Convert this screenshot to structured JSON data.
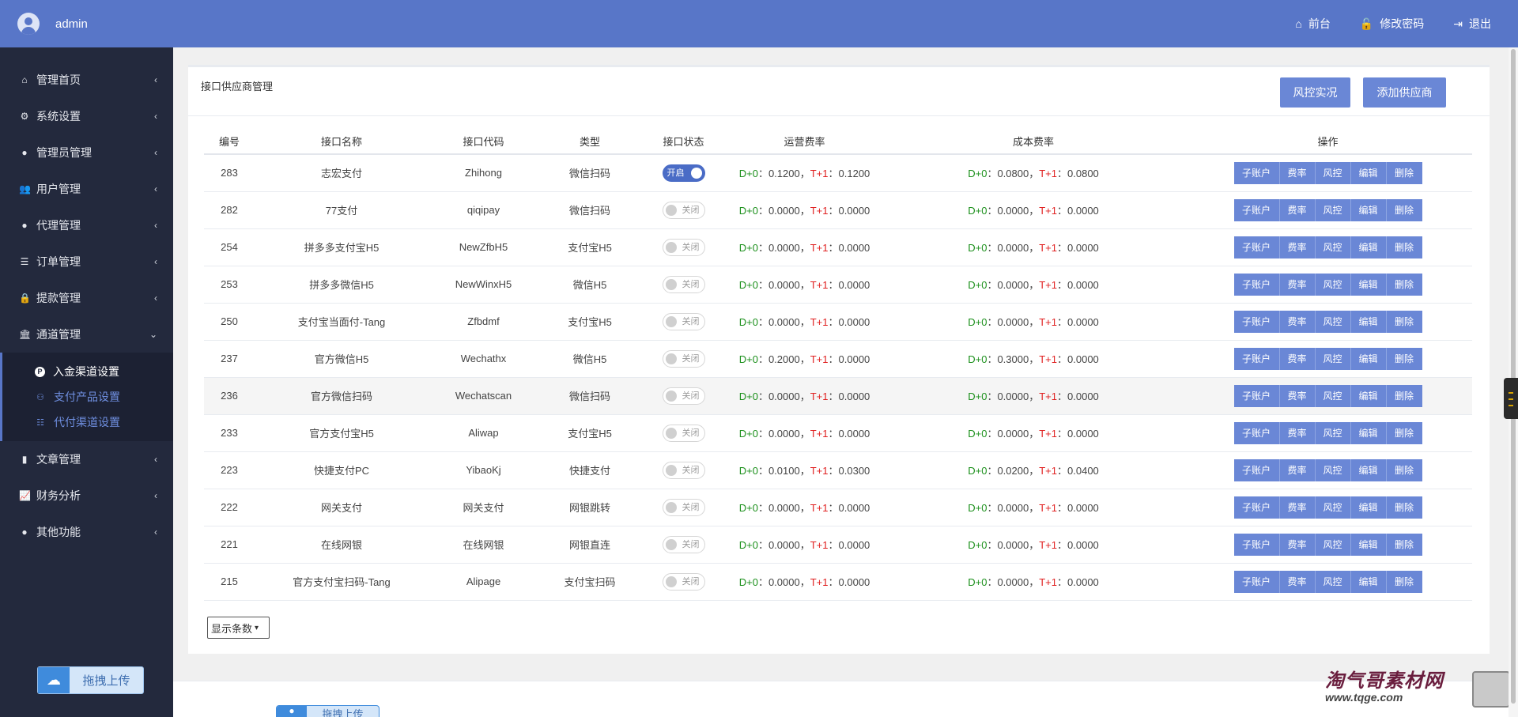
{
  "header": {
    "username": "admin",
    "links": [
      {
        "icon": "home-icon",
        "glyph": "⌂",
        "label": "前台"
      },
      {
        "icon": "lock-icon",
        "glyph": "🔓",
        "label": "修改密码"
      },
      {
        "icon": "logout-icon",
        "glyph": "⇥",
        "label": "退出"
      }
    ]
  },
  "sidebar": {
    "items": [
      {
        "label": "管理首页",
        "glyph": "⌂"
      },
      {
        "label": "系统设置",
        "glyph": "⚙"
      },
      {
        "label": "管理员管理",
        "glyph": "●"
      },
      {
        "label": "用户管理",
        "glyph": "👥"
      },
      {
        "label": "代理管理",
        "glyph": "●"
      },
      {
        "label": "订单管理",
        "glyph": "☰"
      },
      {
        "label": "提款管理",
        "glyph": "🔒"
      },
      {
        "label": "通道管理",
        "glyph": "🏛"
      },
      {
        "label": "文章管理",
        "glyph": "▮"
      },
      {
        "label": "财务分析",
        "glyph": "📈"
      },
      {
        "label": "其他功能",
        "glyph": "●"
      }
    ],
    "sub_items": [
      {
        "label": "入金渠道设置",
        "glyph": "P",
        "active": true
      },
      {
        "label": "支付产品设置",
        "glyph": "⚇",
        "active": false
      },
      {
        "label": "代付渠道设置",
        "glyph": "☷",
        "active": false
      }
    ],
    "upload_label": "拖拽上传"
  },
  "panel": {
    "title": "接口供应商管理",
    "risk_button": "风控实况",
    "add_button": "添加供应商"
  },
  "table": {
    "headers": [
      "编号",
      "接口名称",
      "接口代码",
      "类型",
      "接口状态",
      "运营费率",
      "成本费率",
      "操作"
    ],
    "rows": [
      {
        "id": "283",
        "name": "志宏支付",
        "code": "Zhihong",
        "type": "微信扫码",
        "status": "开启",
        "on": true,
        "op_d0": "0.1200",
        "op_t1": "0.1200",
        "cost_d0": "0.0800",
        "cost_t1": "0.0800"
      },
      {
        "id": "282",
        "name": "77支付",
        "code": "qiqipay",
        "type": "微信扫码",
        "status": "关闭",
        "on": false,
        "op_d0": "0.0000",
        "op_t1": "0.0000",
        "cost_d0": "0.0000",
        "cost_t1": "0.0000"
      },
      {
        "id": "254",
        "name": "拼多多支付宝H5",
        "code": "NewZfbH5",
        "type": "支付宝H5",
        "status": "关闭",
        "on": false,
        "op_d0": "0.0000",
        "op_t1": "0.0000",
        "cost_d0": "0.0000",
        "cost_t1": "0.0000"
      },
      {
        "id": "253",
        "name": "拼多多微信H5",
        "code": "NewWinxH5",
        "type": "微信H5",
        "status": "关闭",
        "on": false,
        "op_d0": "0.0000",
        "op_t1": "0.0000",
        "cost_d0": "0.0000",
        "cost_t1": "0.0000"
      },
      {
        "id": "250",
        "name": "支付宝当面付-Tang",
        "code": "Zfbdmf",
        "type": "支付宝H5",
        "status": "关闭",
        "on": false,
        "op_d0": "0.0000",
        "op_t1": "0.0000",
        "cost_d0": "0.0000",
        "cost_t1": "0.0000"
      },
      {
        "id": "237",
        "name": "官方微信H5",
        "code": "Wechathx",
        "type": "微信H5",
        "status": "关闭",
        "on": false,
        "op_d0": "0.2000",
        "op_t1": "0.0000",
        "cost_d0": "0.3000",
        "cost_t1": "0.0000"
      },
      {
        "id": "236",
        "name": "官方微信扫码",
        "code": "Wechatscan",
        "type": "微信扫码",
        "status": "关闭",
        "on": false,
        "op_d0": "0.0000",
        "op_t1": "0.0000",
        "cost_d0": "0.0000",
        "cost_t1": "0.0000"
      },
      {
        "id": "233",
        "name": "官方支付宝H5",
        "code": "Aliwap",
        "type": "支付宝H5",
        "status": "关闭",
        "on": false,
        "op_d0": "0.0000",
        "op_t1": "0.0000",
        "cost_d0": "0.0000",
        "cost_t1": "0.0000"
      },
      {
        "id": "223",
        "name": "快捷支付PC",
        "code": "YibaoKj",
        "type": "快捷支付",
        "status": "关闭",
        "on": false,
        "op_d0": "0.0100",
        "op_t1": "0.0300",
        "cost_d0": "0.0200",
        "cost_t1": "0.0400"
      },
      {
        "id": "222",
        "name": "网关支付",
        "code": "网关支付",
        "type": "网银跳转",
        "status": "关闭",
        "on": false,
        "op_d0": "0.0000",
        "op_t1": "0.0000",
        "cost_d0": "0.0000",
        "cost_t1": "0.0000"
      },
      {
        "id": "221",
        "name": "在线网银",
        "code": "在线网银",
        "type": "网银直连",
        "status": "关闭",
        "on": false,
        "op_d0": "0.0000",
        "op_t1": "0.0000",
        "cost_d0": "0.0000",
        "cost_t1": "0.0000"
      },
      {
        "id": "215",
        "name": "官方支付宝扫码-Tang",
        "code": "Alipage",
        "type": "支付宝扫码",
        "status": "关闭",
        "on": false,
        "op_d0": "0.0000",
        "op_t1": "0.0000",
        "cost_d0": "0.0000",
        "cost_t1": "0.0000"
      }
    ],
    "d0_label": "D+0",
    "t1_label": "T+1",
    "actions": [
      "子账户",
      "费率",
      "风控",
      "编辑",
      "删除"
    ]
  },
  "page_size_label": "显示条数",
  "footer_upload_label": "拖拽上传",
  "watermark": {
    "title": "淘气哥素材网",
    "url": "www.tqge.com"
  },
  "colors": {
    "header": "#5876c8",
    "sidebar": "#23293d",
    "button": "#6a87d6",
    "green": "#1a8f1a",
    "red": "#e02020"
  }
}
